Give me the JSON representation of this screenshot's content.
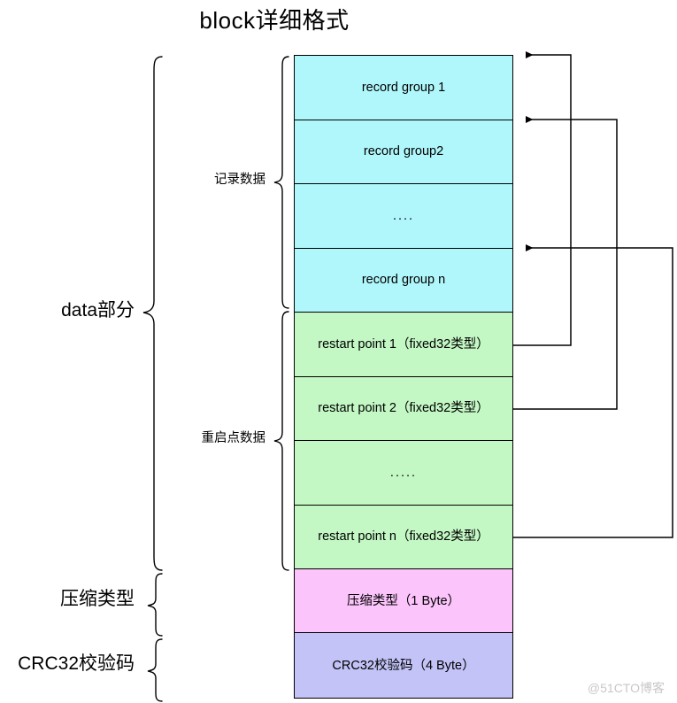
{
  "title": "block详细格式",
  "watermark": "@51CTO博客",
  "colors": {
    "record_group": "#b0f7fb",
    "restart_point": "#c3f8c4",
    "compression_type": "#fbc4fb",
    "crc32": "#c3c3f7",
    "stroke": "#000000",
    "watermark": "#c8c8c8"
  },
  "section_labels": {
    "data_part": "data部分",
    "record_data": "记录数据",
    "restart_data": "重启点数据",
    "compression_type": "压缩类型",
    "crc32": "CRC32校验码"
  },
  "blocks": [
    {
      "id": "record-group-1",
      "label": "record group 1",
      "group": "record_data",
      "color": "#b0f7fb"
    },
    {
      "id": "record-group-2",
      "label": "record group2",
      "group": "record_data",
      "color": "#b0f7fb"
    },
    {
      "id": "record-group-ellipsis",
      "label": "....",
      "group": "record_data",
      "color": "#b0f7fb"
    },
    {
      "id": "record-group-n",
      "label": "record group n",
      "group": "record_data",
      "color": "#b0f7fb"
    },
    {
      "id": "restart-point-1",
      "label": "restart point 1（fixed32类型）",
      "group": "restart_data",
      "color": "#c3f8c4"
    },
    {
      "id": "restart-point-2",
      "label": "restart point 2（fixed32类型）",
      "group": "restart_data",
      "color": "#c3f8c4"
    },
    {
      "id": "restart-point-ellipsis",
      "label": ".....",
      "group": "restart_data",
      "color": "#c3f8c4"
    },
    {
      "id": "restart-point-n",
      "label": "restart point n（fixed32类型）",
      "group": "restart_data",
      "color": "#c3f8c4"
    },
    {
      "id": "compression-type",
      "label": "压缩类型（1 Byte）",
      "group": "compression",
      "color": "#fbc4fb"
    },
    {
      "id": "crc32",
      "label": "CRC32校验码（4 Byte）",
      "group": "crc32",
      "color": "#c3c3f7"
    }
  ],
  "connectors": [
    {
      "from": "restart-point-1",
      "to": "record-group-1",
      "arrow": "left"
    },
    {
      "from": "restart-point-2",
      "to": "record-group-2",
      "arrow": "left"
    },
    {
      "from": "restart-point-n",
      "to": "record-group-n",
      "arrow": "left"
    }
  ]
}
